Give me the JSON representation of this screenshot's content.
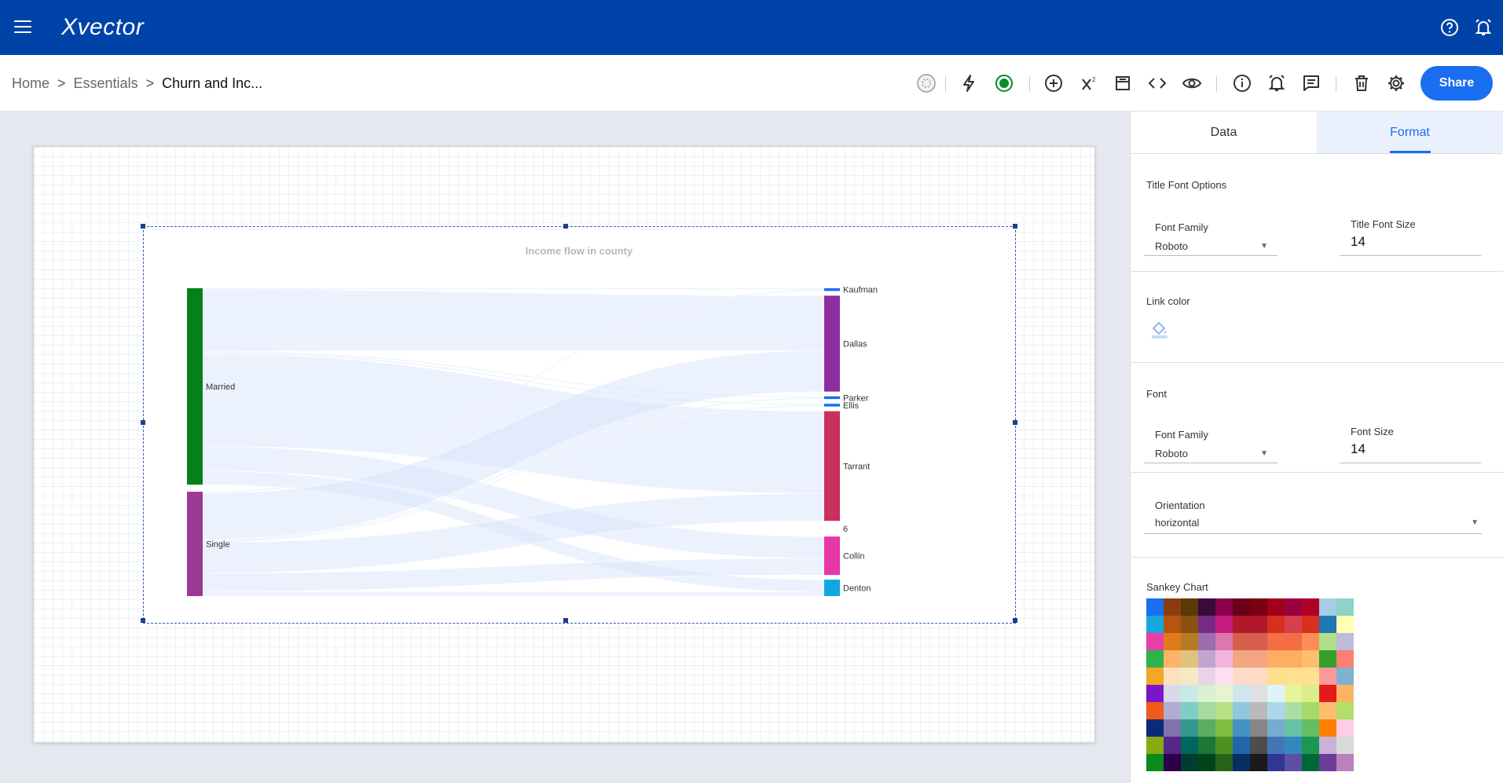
{
  "app": {
    "brand": "Xvector"
  },
  "breadcrumb": {
    "items": [
      "Home",
      "Essentials",
      "Churn and Inc..."
    ],
    "sep": ">"
  },
  "toolbar": {
    "share_label": "Share"
  },
  "panel": {
    "tabs": [
      {
        "label": "Data"
      },
      {
        "label": "Format"
      }
    ],
    "title_font": {
      "section": "Title Font Options",
      "family_label": "Font Family",
      "family_value": "Roboto",
      "size_label": "Title Font Size",
      "size_value": "14"
    },
    "link_color": {
      "section": "Link color"
    },
    "font": {
      "section": "Font",
      "family_label": "Font Family",
      "family_value": "Roboto",
      "size_label": "Font Size",
      "size_value": "14"
    },
    "orientation": {
      "label": "Orientation",
      "value": "horizontal"
    },
    "palette": {
      "section": "Sankey Chart",
      "colors": [
        "#1a6ef0",
        "#8c3c10",
        "#5a3a06",
        "#3a0a3a",
        "#8a004a",
        "#6a001a",
        "#7a0010",
        "#a0001a",
        "#9a0040",
        "#b0002a",
        "#a6cde3",
        "#8dd3c7",
        "#16a8dc",
        "#b65412",
        "#8a5210",
        "#762a83",
        "#c51b7d",
        "#b2182b",
        "#b2182b",
        "#d7301f",
        "#d6404e",
        "#d7301f",
        "#1f78b4",
        "#ffffb3",
        "#e83fa6",
        "#e07b1a",
        "#b87a25",
        "#9970ab",
        "#de77ae",
        "#d6604d",
        "#d6604d",
        "#f46d43",
        "#f46d43",
        "#fc8d59",
        "#b2df8a",
        "#bebada",
        "#2ab44a",
        "#fdb46a",
        "#dfc27d",
        "#c2a5cf",
        "#f1b6da",
        "#f4a582",
        "#f4a582",
        "#fdae61",
        "#fdae61",
        "#fdbf6f",
        "#33a02c",
        "#fb8072",
        "#f5a623",
        "#fde0c0",
        "#f6e8c3",
        "#e7d4e8",
        "#fde0ef",
        "#fddbc7",
        "#fddbc7",
        "#fee08b",
        "#fee090",
        "#fee090",
        "#fb9a99",
        "#80b1d3",
        "#7b16c8",
        "#d8daeb",
        "#c7eae5",
        "#d9f0d3",
        "#e6f5d0",
        "#d1e5f0",
        "#e0e0e0",
        "#e0f3f8",
        "#e6f598",
        "#d9ef8b",
        "#e31a1c",
        "#fdb462",
        "#f05a1a",
        "#b2abd2",
        "#80cdc1",
        "#a6dba0",
        "#b8e186",
        "#92c5de",
        "#bababa",
        "#abd9e9",
        "#abdda4",
        "#a6d96a",
        "#fdbf6f",
        "#b3de69",
        "#0a2a7a",
        "#8073ac",
        "#35978f",
        "#5aae61",
        "#7fbc41",
        "#4393c3",
        "#878787",
        "#74add1",
        "#66c2a5",
        "#66bd63",
        "#ff7f00",
        "#fccde5",
        "#8aaa10",
        "#542788",
        "#01665e",
        "#1b7837",
        "#4d9221",
        "#2166ac",
        "#4d4d4d",
        "#4575b4",
        "#3288bd",
        "#1a9850",
        "#cab2d6",
        "#d9d9d9",
        "#0a8a1a",
        "#2d004b",
        "#003c30",
        "#00441b",
        "#276419",
        "#053061",
        "#1a1a1a",
        "#313695",
        "#5e4fa2",
        "#006837",
        "#6a3d9a",
        "#bc80bd"
      ]
    }
  },
  "chart_data": {
    "type": "sankey",
    "title": "Income flow in county",
    "sources": [
      {
        "name": "Married",
        "color": "#08801a",
        "value": 64
      },
      {
        "name": "Single",
        "color": "#9a3a96",
        "value": 34
      }
    ],
    "targets": [
      {
        "name": "Kaufman",
        "color": "#1a6ef0",
        "value": 1
      },
      {
        "name": "Dallas",
        "color": "#8e2e9e",
        "value": 35
      },
      {
        "name": "Parker",
        "color": "#1a6ef0",
        "value": 1
      },
      {
        "name": "Ellis",
        "color": "#1a6ef0",
        "value": 1
      },
      {
        "name": "Tarrant",
        "color": "#c8305e",
        "value": 40
      },
      {
        "name": "6",
        "color": "#ffffff",
        "value": 0
      },
      {
        "name": "Collin",
        "color": "#e636a8",
        "value": 14
      },
      {
        "name": "Denton",
        "color": "#0ea8e0",
        "value": 6
      }
    ],
    "links": [
      {
        "source": "Married",
        "target": "Kaufman",
        "value": 0.5
      },
      {
        "source": "Married",
        "target": "Dallas",
        "value": 20
      },
      {
        "source": "Married",
        "target": "Parker",
        "value": 0.5
      },
      {
        "source": "Married",
        "target": "Ellis",
        "value": 0.5
      },
      {
        "source": "Married",
        "target": "Tarrant",
        "value": 30
      },
      {
        "source": "Married",
        "target": "Collin",
        "value": 8
      },
      {
        "source": "Married",
        "target": "Denton",
        "value": 4.5
      },
      {
        "source": "Single",
        "target": "Kaufman",
        "value": 0.5
      },
      {
        "source": "Single",
        "target": "Dallas",
        "value": 15
      },
      {
        "source": "Single",
        "target": "Parker",
        "value": 0.5
      },
      {
        "source": "Single",
        "target": "Ellis",
        "value": 0.5
      },
      {
        "source": "Single",
        "target": "Tarrant",
        "value": 10
      },
      {
        "source": "Single",
        "target": "Collin",
        "value": 6
      },
      {
        "source": "Single",
        "target": "Denton",
        "value": 1.5
      }
    ]
  }
}
